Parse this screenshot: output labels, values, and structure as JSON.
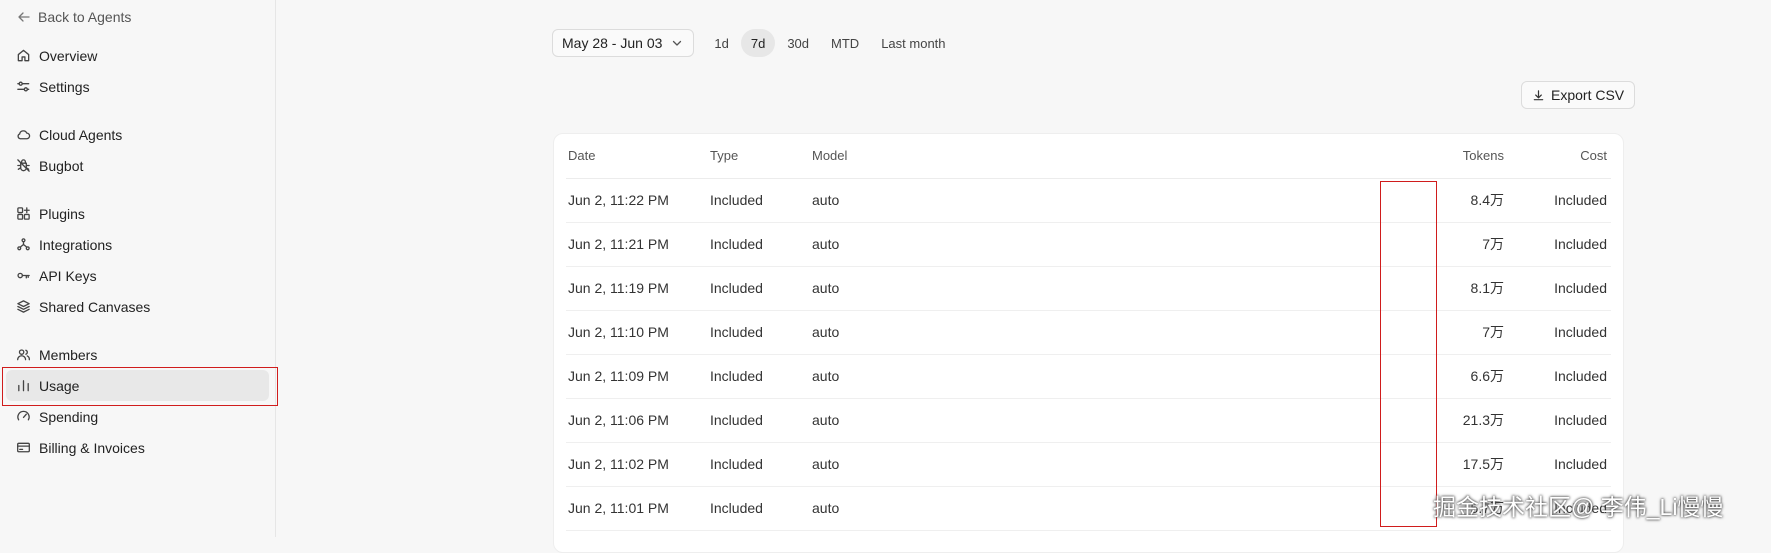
{
  "sidebar": {
    "back_label": "Back to Agents",
    "groups": [
      [
        {
          "label": "Overview",
          "icon": "home-icon"
        },
        {
          "label": "Settings",
          "icon": "sliders-icon"
        }
      ],
      [
        {
          "label": "Cloud Agents",
          "icon": "cloud-icon"
        },
        {
          "label": "Bugbot",
          "icon": "bug-icon"
        }
      ],
      [
        {
          "label": "Plugins",
          "icon": "plugins-icon"
        },
        {
          "label": "Integrations",
          "icon": "integrations-icon"
        },
        {
          "label": "API Keys",
          "icon": "key-icon"
        },
        {
          "label": "Shared Canvases",
          "icon": "layers-icon"
        }
      ],
      [
        {
          "label": "Members",
          "icon": "users-icon"
        },
        {
          "label": "Usage",
          "icon": "bar-chart-icon",
          "active": true
        },
        {
          "label": "Spending",
          "icon": "gauge-icon"
        },
        {
          "label": "Billing & Invoices",
          "icon": "card-icon"
        }
      ]
    ]
  },
  "filters": {
    "date_range": "May 28 - Jun 03",
    "ranges": [
      "1d",
      "7d",
      "30d",
      "MTD",
      "Last month"
    ],
    "selected_range": "7d"
  },
  "export_label": "Export CSV",
  "table": {
    "columns": [
      "Date",
      "Type",
      "Model",
      "Tokens",
      "Cost"
    ],
    "rows": [
      {
        "date": "Jun 2, 11:22 PM",
        "type": "Included",
        "model": "auto",
        "tokens": "8.4万",
        "cost": "Included"
      },
      {
        "date": "Jun 2, 11:21 PM",
        "type": "Included",
        "model": "auto",
        "tokens": "7万",
        "cost": "Included"
      },
      {
        "date": "Jun 2, 11:19 PM",
        "type": "Included",
        "model": "auto",
        "tokens": "8.1万",
        "cost": "Included"
      },
      {
        "date": "Jun 2, 11:10 PM",
        "type": "Included",
        "model": "auto",
        "tokens": "7万",
        "cost": "Included"
      },
      {
        "date": "Jun 2, 11:09 PM",
        "type": "Included",
        "model": "auto",
        "tokens": "6.6万",
        "cost": "Included"
      },
      {
        "date": "Jun 2, 11:06 PM",
        "type": "Included",
        "model": "auto",
        "tokens": "21.3万",
        "cost": "Included"
      },
      {
        "date": "Jun 2, 11:02 PM",
        "type": "Included",
        "model": "auto",
        "tokens": "17.5万",
        "cost": "Included"
      },
      {
        "date": "Jun 2, 11:01 PM",
        "type": "Included",
        "model": "auto",
        "tokens": "5.7万",
        "cost": "Included"
      }
    ]
  },
  "watermark": "掘金技术社区@ 李伟_Li慢慢",
  "colors": {
    "highlight": "#d01c1c",
    "active_bg": "#e8e8e8",
    "page_bg": "#f7f7f7"
  }
}
